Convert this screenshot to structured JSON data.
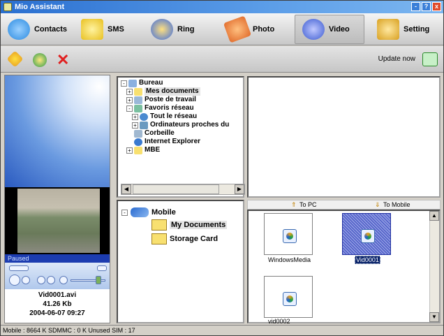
{
  "window": {
    "title": "Mio Assistant",
    "buttons": [
      "-",
      "?",
      "x"
    ]
  },
  "tabs": [
    {
      "label": "Contacts",
      "icon": "contacts-icon",
      "color": "#2a8ae0"
    },
    {
      "label": "SMS",
      "icon": "sms-icon",
      "color": "#e8c020"
    },
    {
      "label": "Ring",
      "icon": "ring-icon",
      "color": "#3a6ae0"
    },
    {
      "label": "Photo",
      "icon": "photo-icon",
      "color": "#e06a2a"
    },
    {
      "label": "Video",
      "icon": "video-icon",
      "color": "#3a5ad0"
    },
    {
      "label": "Setting",
      "icon": "setting-icon",
      "color": "#d8a020"
    }
  ],
  "active_tab": "Video",
  "actions": {
    "update_label": "Update now"
  },
  "player": {
    "status": "Paused",
    "filename": "Vid0001.avi",
    "size": "41.26 Kb",
    "date": "2004-06-07 09:27"
  },
  "pc_tree": [
    {
      "label": "Bureau",
      "level": 0,
      "expander": "-"
    },
    {
      "label": "Mes documents",
      "level": 1,
      "expander": "+",
      "selected": true
    },
    {
      "label": "Poste de travail",
      "level": 1,
      "expander": "+"
    },
    {
      "label": "Favoris réseau",
      "level": 1,
      "expander": "-"
    },
    {
      "label": "Tout le réseau",
      "level": 2,
      "expander": "+"
    },
    {
      "label": "Ordinateurs proches du",
      "level": 2,
      "expander": "+"
    },
    {
      "label": "Corbeille",
      "level": 1,
      "expander": ""
    },
    {
      "label": "Internet Explorer",
      "level": 1,
      "expander": ""
    },
    {
      "label": "MBE",
      "level": 1,
      "expander": "+"
    }
  ],
  "mobile_tree": {
    "root": "Mobile",
    "children": [
      "My Documents",
      "Storage Card"
    ],
    "selected": "My Documents"
  },
  "transfer": {
    "to_pc": "To PC",
    "to_mobile": "To Mobile"
  },
  "files": [
    {
      "name": "WindowsMedia",
      "selected": false
    },
    {
      "name": "Vid0001",
      "selected": true
    },
    {
      "name": "vid0002",
      "selected": false
    }
  ],
  "status": "Mobile : 8664 K  SDMMC : 0 K  Unused SIM : 17"
}
